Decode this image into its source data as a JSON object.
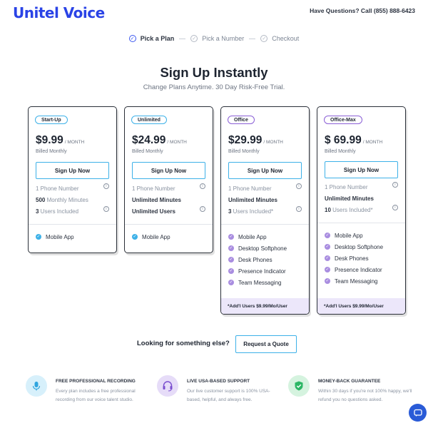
{
  "header": {
    "logo": "Unitel Voice",
    "help_text": "Have Questions? Call (855) 888-6423"
  },
  "steps": [
    {
      "label": "Pick a Plan"
    },
    {
      "label": "Pick a Number"
    },
    {
      "label": "Checkout"
    }
  ],
  "hero": {
    "title": "Sign Up Instantly",
    "subtitle": "Change Plans Anytime. 30 Day Risk-Free Trial."
  },
  "plans": [
    {
      "badge": "Start-Up",
      "price": "$9.99",
      "per": "/ MONTH",
      "billed": "Billed Monthly",
      "button": "Sign Up Now",
      "phone": "1 Phone Number",
      "minutes_num": "500",
      "minutes_text": " Monthly Minutes",
      "users_num": "3",
      "users_text": " Users Included",
      "apps": [
        "Mobile App"
      ]
    },
    {
      "badge": "Unlimited",
      "price": "$24.99",
      "per": "/ MONTH",
      "billed": "Billed Monthly",
      "button": "Sign Up Now",
      "phone": "1 Phone Number",
      "minutes": "Unlimited Minutes",
      "users": "Unlimited Users",
      "apps": [
        "Mobile App"
      ]
    },
    {
      "badge": "Office",
      "price": "$29.99",
      "per": "/ MONTH",
      "billed": "Billed Monthly",
      "button": "Sign Up Now",
      "phone": "1 Phone Number",
      "minutes": "Unlimited Minutes",
      "users_num": "3",
      "users_text": " Users Included*",
      "apps": [
        "Mobile App",
        "Desktop Softphone",
        "Desk Phones",
        "Presence Indicator",
        "Team Messaging"
      ],
      "footer": "*Add'l Users $9.99/Mo/User"
    },
    {
      "badge": "Office-Max",
      "price": "$ 69.99",
      "per": "/ MONTH",
      "billed": "Billed Monthly",
      "button": "Sign Up Now",
      "phone": "1 Phone Number",
      "minutes": "Unlimited Minutes",
      "users_num": "10",
      "users_text": " Users Included*",
      "apps": [
        "Mobile App",
        "Desktop Softphone",
        "Desk Phones",
        "Presence Indicator",
        "Team Messaging"
      ],
      "footer": "*Add'l Users $9.99/Mo/User"
    }
  ],
  "quote": {
    "question": "Looking for something else?",
    "button": "Request a Quote"
  },
  "benefits": [
    {
      "title": "FREE PROFESSIONAL RECORDING",
      "desc": "Every plan includes a free professional recording from our voice talent studio.",
      "icon": "microphone-icon"
    },
    {
      "title": "LIVE USA-BASED SUPPORT",
      "desc": "Our live customer support is 100% USA-based, helpful, and always free.",
      "icon": "headset-icon"
    },
    {
      "title": "MONEY-BACK GUARANTEE",
      "desc": "Within 30 days if you're not 100% happy, we'll refund you no questions asked.",
      "icon": "shield-check-icon"
    }
  ],
  "colors": {
    "brand": "#2a43e6",
    "accent_blue": "#3db1e8",
    "accent_purple": "#8a5fd6",
    "footer_tint": "#ece7fa"
  }
}
